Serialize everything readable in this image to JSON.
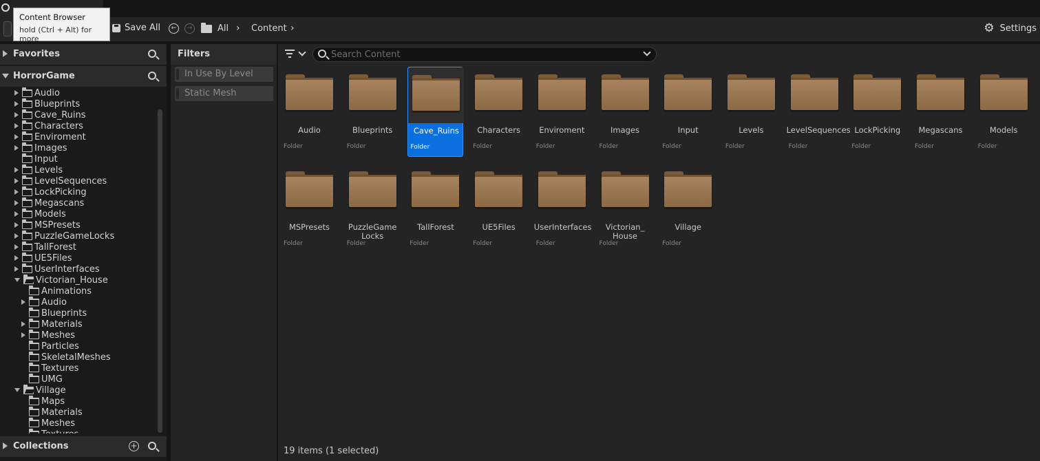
{
  "window": {
    "tooltip_title": "Content Browser",
    "tooltip_hint": "hold (Ctrl + Alt) for more"
  },
  "toolbar": {
    "save_all_label": "Save All",
    "breadcrumb": [
      "All",
      "Content"
    ],
    "settings_label": "Settings"
  },
  "left_panel": {
    "favorites_label": "Favorites",
    "project_label": "HorrorGame",
    "collections_label": "Collections",
    "tree": [
      {
        "label": "Audio",
        "depth": 0,
        "expandable": true,
        "open": false
      },
      {
        "label": "Blueprints",
        "depth": 0,
        "expandable": true,
        "open": false
      },
      {
        "label": "Cave_Ruins",
        "depth": 0,
        "expandable": true,
        "open": false
      },
      {
        "label": "Characters",
        "depth": 0,
        "expandable": true,
        "open": false
      },
      {
        "label": "Enviroment",
        "depth": 0,
        "expandable": true,
        "open": false
      },
      {
        "label": "Images",
        "depth": 0,
        "expandable": true,
        "open": false
      },
      {
        "label": "Input",
        "depth": 0,
        "expandable": false,
        "open": false
      },
      {
        "label": "Levels",
        "depth": 0,
        "expandable": true,
        "open": false
      },
      {
        "label": "LevelSequences",
        "depth": 0,
        "expandable": true,
        "open": false
      },
      {
        "label": "LockPicking",
        "depth": 0,
        "expandable": true,
        "open": false
      },
      {
        "label": "Megascans",
        "depth": 0,
        "expandable": true,
        "open": false
      },
      {
        "label": "Models",
        "depth": 0,
        "expandable": true,
        "open": false
      },
      {
        "label": "MSPresets",
        "depth": 0,
        "expandable": true,
        "open": false
      },
      {
        "label": "PuzzleGameLocks",
        "depth": 0,
        "expandable": true,
        "open": false
      },
      {
        "label": "TallForest",
        "depth": 0,
        "expandable": true,
        "open": false
      },
      {
        "label": "UE5Files",
        "depth": 0,
        "expandable": true,
        "open": false
      },
      {
        "label": "UserInterfaces",
        "depth": 0,
        "expandable": true,
        "open": false
      },
      {
        "label": "Victorian_House",
        "depth": 0,
        "expandable": true,
        "open": true
      },
      {
        "label": "Animations",
        "depth": 1,
        "expandable": false,
        "open": false
      },
      {
        "label": "Audio",
        "depth": 1,
        "expandable": true,
        "open": false
      },
      {
        "label": "Blueprints",
        "depth": 1,
        "expandable": false,
        "open": false
      },
      {
        "label": "Materials",
        "depth": 1,
        "expandable": true,
        "open": false
      },
      {
        "label": "Meshes",
        "depth": 1,
        "expandable": true,
        "open": false
      },
      {
        "label": "Particles",
        "depth": 1,
        "expandable": false,
        "open": false
      },
      {
        "label": "SkeletalMeshes",
        "depth": 1,
        "expandable": false,
        "open": false
      },
      {
        "label": "Textures",
        "depth": 1,
        "expandable": false,
        "open": false
      },
      {
        "label": "UMG",
        "depth": 1,
        "expandable": false,
        "open": false
      },
      {
        "label": "Village",
        "depth": 0,
        "expandable": true,
        "open": true
      },
      {
        "label": "Maps",
        "depth": 1,
        "expandable": false,
        "open": false
      },
      {
        "label": "Materials",
        "depth": 1,
        "expandable": false,
        "open": false
      },
      {
        "label": "Meshes",
        "depth": 1,
        "expandable": false,
        "open": false
      },
      {
        "label": "Textures",
        "depth": 1,
        "expandable": false,
        "open": false
      }
    ]
  },
  "filters": {
    "header": "Filters",
    "chips": [
      "In Use By Level",
      "Static Mesh"
    ]
  },
  "content": {
    "search_placeholder": "Search Content",
    "items": [
      {
        "name": "Audio",
        "type": "Folder",
        "selected": false
      },
      {
        "name": "Blueprints",
        "type": "Folder",
        "selected": false
      },
      {
        "name": "Cave_Ruins",
        "type": "Folder",
        "selected": true
      },
      {
        "name": "Characters",
        "type": "Folder",
        "selected": false
      },
      {
        "name": "Enviroment",
        "type": "Folder",
        "selected": false
      },
      {
        "name": "Images",
        "type": "Folder",
        "selected": false
      },
      {
        "name": "Input",
        "type": "Folder",
        "selected": false
      },
      {
        "name": "Levels",
        "type": "Folder",
        "selected": false
      },
      {
        "name": "LevelSequences",
        "type": "Folder",
        "selected": false
      },
      {
        "name": "LockPicking",
        "type": "Folder",
        "selected": false
      },
      {
        "name": "Megascans",
        "type": "Folder",
        "selected": false
      },
      {
        "name": "Models",
        "type": "Folder",
        "selected": false
      },
      {
        "name": "MSPresets",
        "type": "Folder",
        "selected": false
      },
      {
        "name": "PuzzleGame\nLocks",
        "type": "Folder",
        "selected": false
      },
      {
        "name": "TallForest",
        "type": "Folder",
        "selected": false
      },
      {
        "name": "UE5Files",
        "type": "Folder",
        "selected": false
      },
      {
        "name": "UserInterfaces",
        "type": "Folder",
        "selected": false
      },
      {
        "name": "Victorian_\nHouse",
        "type": "Folder",
        "selected": false
      },
      {
        "name": "Village",
        "type": "Folder",
        "selected": false
      }
    ],
    "status": "19 items (1 selected)"
  },
  "colors": {
    "selection": "#0a70e0",
    "folder": "#a88461"
  }
}
